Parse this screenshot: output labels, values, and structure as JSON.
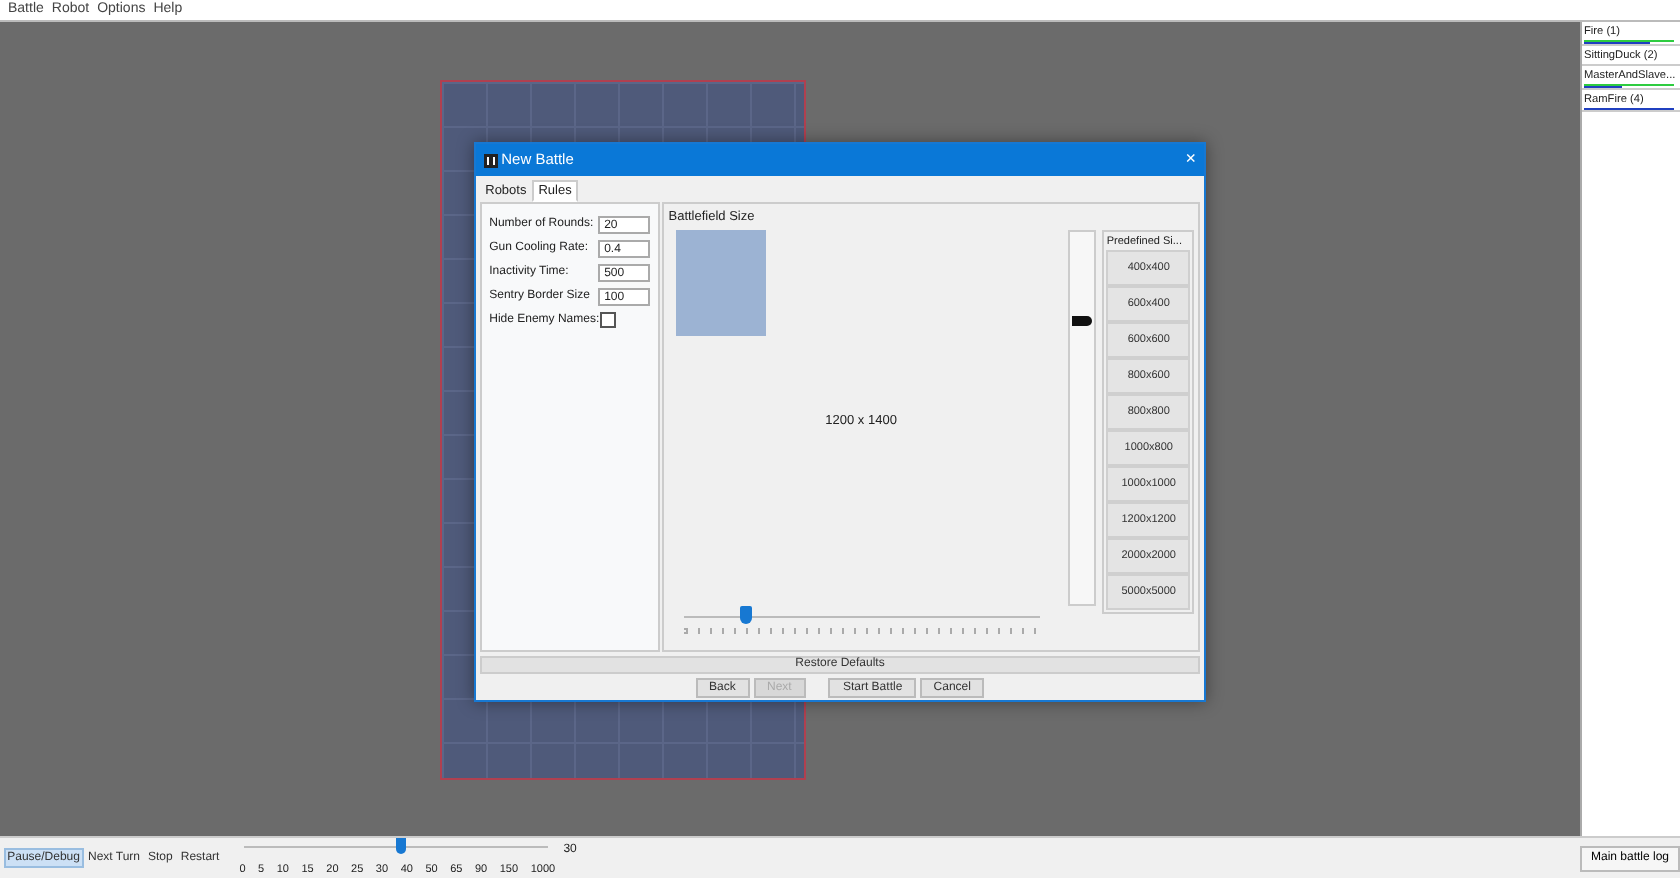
{
  "menu": [
    "Battle",
    "Robot",
    "Options",
    "Help"
  ],
  "robots": [
    {
      "name": "Fire (1)",
      "bars": [
        {
          "kind": "energy",
          "level": 0.95
        },
        {
          "kind": "gun",
          "level": 0.7
        }
      ]
    },
    {
      "name": "SittingDuck (2)"
    },
    {
      "name": "MasterAndSlave...",
      "bars": [
        {
          "kind": "energy",
          "level": 0.95
        },
        {
          "kind": "gun",
          "level": 0.4
        }
      ]
    },
    {
      "name": "RamFire (4)",
      "bars": [
        {
          "kind": "gun",
          "level": 0.95
        }
      ]
    }
  ],
  "dialog": {
    "title": "New Battle",
    "close": "×",
    "tabs": [
      {
        "label": "Robots",
        "selected": false
      },
      {
        "label": "Rules",
        "selected": true
      }
    ],
    "rules": [
      {
        "label": "Number of Rounds:",
        "kind": "text",
        "value": "20"
      },
      {
        "label": "Gun Cooling Rate:",
        "kind": "text",
        "value": "0.4"
      },
      {
        "label": "Inactivity Time:",
        "kind": "text",
        "value": "500"
      },
      {
        "label": "Sentry Border Size",
        "kind": "text",
        "value": "100"
      },
      {
        "label": "Hide Enemy Names:",
        "kind": "check",
        "checked": false
      }
    ],
    "battlefield": {
      "title": "Battlefield Size",
      "size_label": "1200 x 1400",
      "width_slider": {
        "level": 0.17
      },
      "height_slider": {
        "level": 0.77
      }
    },
    "predefined": {
      "title": "Predefined Si...",
      "sizes": [
        "400x400",
        "600x400",
        "600x600",
        "800x600",
        "800x800",
        "1000x800",
        "1000x1000",
        "1200x1200",
        "2000x2000",
        "5000x5000"
      ]
    },
    "restore": "Restore Defaults",
    "buttons": [
      {
        "label": "Back",
        "disabled": false
      },
      {
        "label": "Next",
        "disabled": true
      },
      {
        "label": "Start Battle",
        "disabled": false
      },
      {
        "label": "Cancel",
        "disabled": false
      }
    ]
  },
  "toolbar": {
    "buttons": [
      {
        "label": "Pause/Debug",
        "selected": true
      },
      {
        "label": "Next Turn",
        "selected": false
      },
      {
        "label": "Stop",
        "selected": false
      },
      {
        "label": "Restart",
        "selected": false
      }
    ],
    "speed": {
      "level": 0.5,
      "ticks": [
        "0",
        "5",
        "10",
        "15",
        "20",
        "25",
        "30",
        "40",
        "50",
        "65",
        "90",
        "150",
        "1000"
      ],
      "reading": "30"
    }
  },
  "log_button": "Main battle log"
}
